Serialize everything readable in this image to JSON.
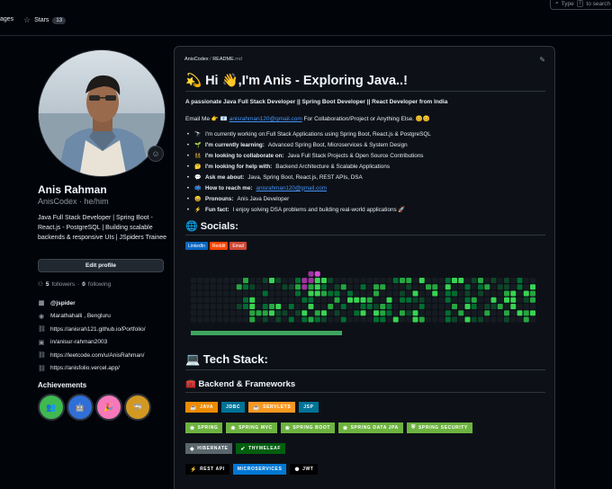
{
  "topbar": {
    "tabs": [
      {
        "label": "ages"
      },
      {
        "label": "Stars",
        "count": "13"
      }
    ],
    "search": {
      "prefix": "Type",
      "key": "/",
      "suffix": "to search"
    }
  },
  "profile": {
    "name": "Anis Rahman",
    "handle": "AnisCodex",
    "pronouns": "he/him",
    "bio": "Java Full Stack Developer | Spring Boot - React.js - PostgreSQL | Building scalable backends & responsive UIs | JSpiders Trainee",
    "edit_label": "Edit profile",
    "followers_count": "5",
    "followers_label": "followers",
    "following_count": "0",
    "following_label": "following",
    "details": [
      {
        "icon": "organization-icon",
        "text": "@jspider"
      },
      {
        "icon": "location-icon",
        "text": "Marathahalli , Bengluru"
      },
      {
        "icon": "link-icon",
        "text": "https://anisrah121.github.io/Portfolio/"
      },
      {
        "icon": "linkedin-icon",
        "text": "in/anisur-rahman2003"
      },
      {
        "icon": "link-icon",
        "text": "https://leetcode.com/u/AnisRahman/"
      },
      {
        "icon": "link-icon",
        "text": "https://anisfolio.vercel.app/"
      }
    ],
    "achievements_title": "Achievements",
    "achievements": [
      {
        "icon": "pair-extraordinaire-icon",
        "color": "#3fb950"
      },
      {
        "icon": "quickdraw-icon",
        "color": "#2f6fd8"
      },
      {
        "icon": "yolo-icon",
        "color": "#f778ba"
      },
      {
        "icon": "pull-shark-icon",
        "color": "#d29922"
      }
    ]
  },
  "readme": {
    "path_user": "AnisCodex",
    "path_sep": "/",
    "path_file": "README",
    "path_ext": ".md",
    "title": "💫 Hi 👋,I'm Anis - Exploring Java..!",
    "tagline": "A passionate Java Full Stack Developer || Spring Boot Developer || React Developer from India",
    "email_prefix": "Email Me 👉 📧",
    "email": "anisrahman120@gmail.com",
    "email_suffix": "For Collaboration/Project or Anything Else. 😊😊",
    "facts": [
      {
        "emoji": "🔭",
        "label": "",
        "text": "I'm currently working on:Full Stack Applications using Spring Boot, React.js & PostgreSQL"
      },
      {
        "emoji": "🌱",
        "label": "I'm currently learning:",
        "text": "Advanced Spring Boot, Microservices & System Design"
      },
      {
        "emoji": "👯",
        "label": "I'm looking to collaborate on:",
        "text": "Java Full Stack Projects & Open Source Contributions"
      },
      {
        "emoji": "🤔",
        "label": "I'm looking for help with:",
        "text": "Backend Architecture & Scalable Applications"
      },
      {
        "emoji": "💬",
        "label": "Ask me about:",
        "text": "Java, Spring Boot, React.js, REST APIs, DSA"
      },
      {
        "emoji": "📫",
        "label": "How to reach me:",
        "text": "anisrahman120@gmail.com",
        "is_link": true
      },
      {
        "emoji": "😄",
        "label": "Pronouns:",
        "text": "Anis Java Developer"
      },
      {
        "emoji": "⚡",
        "label": "Fun fact:",
        "text": "I enjoy solving DSA problems and building real-world applications 🚀"
      }
    ],
    "socials_title": "🌐 Socials:",
    "socials": [
      {
        "label": "LinkedIn",
        "color": "#0a66c2"
      },
      {
        "label": "Reddit",
        "color": "#ff4500"
      },
      {
        "label": "Email",
        "color": "#d14836"
      }
    ],
    "tech_title": "💻 Tech Stack:",
    "backend_title": "🧰 Backend & Frameworks",
    "tech_rows": [
      [
        {
          "label": "JAVA",
          "color": "#ed8b00",
          "icon": "java-icon"
        },
        {
          "label": "JDBC",
          "color": "#007396",
          "icon": ""
        },
        {
          "label": "SERVLETS",
          "color": "#f89820",
          "icon": "java-icon"
        },
        {
          "label": "JSP",
          "color": "#007396",
          "icon": ""
        }
      ],
      [
        {
          "label": "SPRING",
          "color": "#6db33f",
          "icon": "spring-icon"
        },
        {
          "label": "SPRING MVC",
          "color": "#6db33f",
          "icon": "spring-icon"
        },
        {
          "label": "SPRING BOOT",
          "color": "#6db33f",
          "icon": "spring-icon"
        },
        {
          "label": "SPRING DATA JPA",
          "color": "#6db33f",
          "icon": "spring-icon"
        },
        {
          "label": "SPRING SECURITY",
          "color": "#6db33f",
          "icon": "shield-icon"
        }
      ],
      [
        {
          "label": "HIBERNATE",
          "color": "#59666c",
          "icon": "hibernate-icon"
        },
        {
          "label": "THYMELEAF",
          "color": "#005f0f",
          "icon": "check-icon"
        }
      ],
      [
        {
          "label": "REST API",
          "color": "#000000",
          "icon": "api-icon"
        },
        {
          "label": "MICROSERVICES",
          "color": "#0078d4",
          "icon": ""
        },
        {
          "label": "JWT",
          "color": "#000000",
          "icon": "jwt-icon"
        }
      ]
    ]
  }
}
